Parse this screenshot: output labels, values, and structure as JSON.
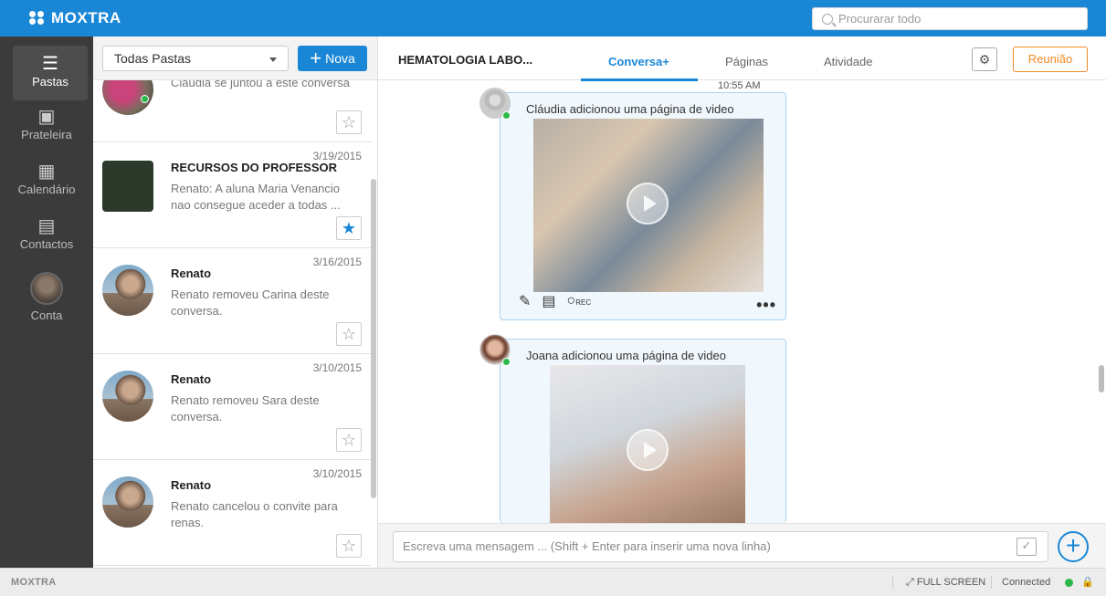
{
  "app": {
    "logo": "MOXTRA"
  },
  "search": {
    "placeholder": "Procurarar todo"
  },
  "nav": [
    {
      "label": "Pastas",
      "icon": "list-icon"
    },
    {
      "label": "Prateleira",
      "icon": "shelf-icon"
    },
    {
      "label": "Calendário",
      "icon": "calendar-icon"
    },
    {
      "label": "Contactos",
      "icon": "contacts-icon"
    },
    {
      "label": "Conta",
      "icon": "account-avatar"
    }
  ],
  "list": {
    "folder": "Todas Pastas",
    "new_label": "Nova",
    "items": [
      {
        "title": "",
        "date": "",
        "message": "Cláudia se juntou a este conversa",
        "starred": false
      },
      {
        "title": "RECURSOS DO PROFESSOR",
        "date": "3/19/2015",
        "message": "Renato: A aluna Maria Venancio nao consegue aceder a todas ...",
        "starred": true
      },
      {
        "title": "Renato",
        "date": "3/16/2015",
        "message": "Renato removeu Carina deste conversa.",
        "starred": false
      },
      {
        "title": "Renato",
        "date": "3/10/2015",
        "message": "Renato removeu Sara deste conversa.",
        "starred": false
      },
      {
        "title": "Renato",
        "date": "3/10/2015",
        "message": "Renato cancelou o convite para renas.",
        "starred": false
      }
    ]
  },
  "main": {
    "title": "HEMATOLOGIA LABO...",
    "tabs": [
      "Conversa+",
      "Páginas",
      "Atividade"
    ],
    "meeting_label": "Reunião",
    "time": "10:55 AM",
    "feed": [
      {
        "text": "Cláudia adicionou uma página de video"
      },
      {
        "text": "Joana adicionou uma página de video"
      }
    ],
    "rec_label": "REC",
    "compose_placeholder": "Escreva uma mensagem ... (Shift + Enter para inserir uma nova linha)"
  },
  "status": {
    "logo": "MOXTRA",
    "fullscreen": "FULL SCREEN",
    "connection": "Connected"
  },
  "colors": {
    "brand": "#1a87d6",
    "accent": "#f08a24",
    "online": "#2db84b"
  }
}
